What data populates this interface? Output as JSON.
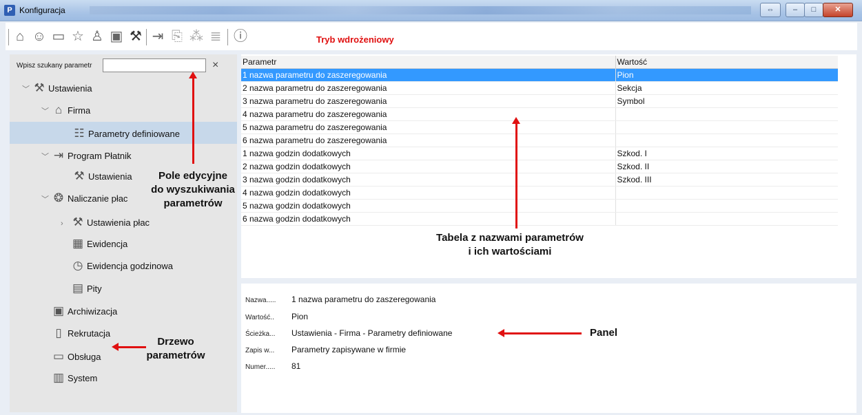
{
  "window": {
    "title": "Konfiguracja",
    "app_icon": "P"
  },
  "toolbar": {
    "mode_label": "Tryb wdrożeniowy",
    "icons": [
      "home-icon",
      "user-icon",
      "monitor-icon",
      "star-icon",
      "person-icon",
      "screen-icon",
      "tools-icon",
      "arrow-right-icon",
      "doc-x-icon",
      "group-icon",
      "list-icon",
      "help-icon"
    ]
  },
  "search": {
    "label": "Wpisz szukany parametr",
    "value": "",
    "clear": "×"
  },
  "tree": {
    "items": [
      {
        "label": "Ustawienia",
        "chevron": "﹀",
        "icon": "⚒"
      },
      {
        "label": "Firma",
        "chevron": "﹀",
        "icon": "⌂"
      },
      {
        "label": "Parametry definiowane",
        "chevron": "",
        "icon": "☷"
      },
      {
        "label": "Program Płatnik",
        "chevron": "﹀",
        "icon": "⇥"
      },
      {
        "label": "Ustawienia",
        "chevron": "",
        "icon": "⚒"
      },
      {
        "label": "Naliczanie płac",
        "chevron": "﹀",
        "icon": "❂"
      },
      {
        "label": "Ustawienia płac",
        "chevron": "›",
        "icon": "⚒"
      },
      {
        "label": "Ewidencja",
        "chevron": "",
        "icon": "▦"
      },
      {
        "label": "Ewidencja godzinowa",
        "chevron": "",
        "icon": "◷"
      },
      {
        "label": "Pity",
        "chevron": "",
        "icon": "▤"
      },
      {
        "label": "Archiwizacja",
        "chevron": "",
        "icon": "▣"
      },
      {
        "label": "Rekrutacja",
        "chevron": "",
        "icon": "▯"
      },
      {
        "label": "Obsługa",
        "chevron": "",
        "icon": "▭"
      },
      {
        "label": "System",
        "chevron": "",
        "icon": "▥"
      }
    ]
  },
  "table": {
    "columns": [
      "Parametr",
      "Wartość"
    ],
    "rows": [
      [
        "1 nazwa parametru do zaszeregowania",
        "Pion"
      ],
      [
        "2 nazwa parametru do zaszeregowania",
        "Sekcja"
      ],
      [
        "3 nazwa parametru do zaszeregowania",
        "Symbol"
      ],
      [
        "4 nazwa parametru do zaszeregowania",
        ""
      ],
      [
        "5 nazwa parametru do zaszeregowania",
        ""
      ],
      [
        "6 nazwa parametru do zaszeregowania",
        ""
      ],
      [
        "1 nazwa godzin dodatkowych",
        "Szkod. I"
      ],
      [
        "2 nazwa godzin dodatkowych",
        "Szkod. II"
      ],
      [
        "3 nazwa godzin dodatkowych",
        "Szkod. III"
      ],
      [
        "4 nazwa godzin dodatkowych",
        ""
      ],
      [
        "5 nazwa godzin dodatkowych",
        ""
      ],
      [
        "6 nazwa godzin dodatkowych",
        ""
      ]
    ]
  },
  "panel": {
    "fields": [
      {
        "label": "Nazwa.....",
        "value": "1 nazwa parametru do zaszeregowania"
      },
      {
        "label": "Wartość..",
        "value": "Pion"
      },
      {
        "label": "Ścieżka...",
        "value": "Ustawienia - Firma - Parametry definiowane"
      },
      {
        "label": "Zapis w...",
        "value": "Parametry zapisywane w firmie"
      },
      {
        "label": "Numer.....",
        "value": "81"
      }
    ]
  },
  "annotations": {
    "search": [
      "Pole edycyjne",
      "do wyszukiwania",
      "parametrów"
    ],
    "table": [
      "Tabela z nazwami parametrów",
      "i ich wartościami"
    ],
    "panel": "Panel",
    "tree": [
      "Drzewo",
      "parametrów"
    ]
  },
  "colors": {
    "selection": "#3399ff",
    "accent_red": "#e01010",
    "tree_selected": "#c7d8ea"
  }
}
